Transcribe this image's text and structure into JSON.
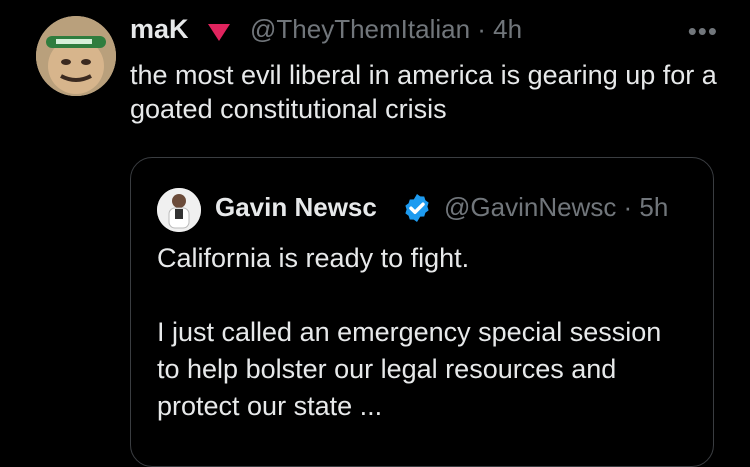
{
  "tweet": {
    "author_name": "maK",
    "handle_time": "@TheyThemItalian · 4h",
    "more_label": "•••",
    "text": "the most evil liberal in america is gearing up for a goated constitutional crisis"
  },
  "quoted_tweet": {
    "author_name": "Gavin Newsc",
    "handle_time": "@GavinNewsc · 5h",
    "text": "California is ready to fight.\n\nI just called an emergency special session to help bolster our legal resources and protect our state ..."
  },
  "colors": {
    "background": "#000000",
    "text": "#e7e9ea",
    "muted": "#71767b",
    "verified": "#1d9bf0",
    "badge": "#e0245e"
  },
  "icons": [
    "avatar-image",
    "red-triangle-icon",
    "more-icon",
    "verified-icon"
  ]
}
